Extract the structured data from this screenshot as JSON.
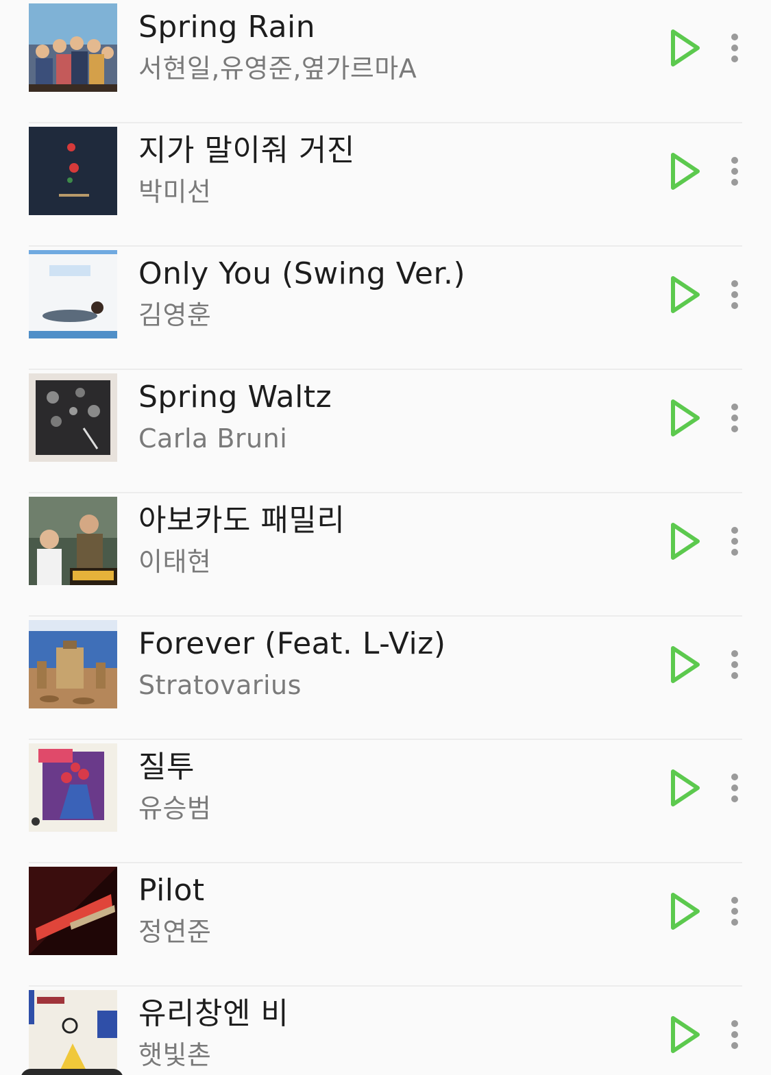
{
  "colors": {
    "accent": "#5cc94e",
    "title": "#1d1d1d",
    "artist": "#7a7a7a",
    "more": "#9a9a9a"
  },
  "songs": [
    {
      "title": "Spring Rain",
      "artist": "서현일,유영준,옆가르마A"
    },
    {
      "title": "지가 말이줘 거진",
      "artist": "박미선"
    },
    {
      "title": "Only You (Swing Ver.)",
      "artist": "김영훈"
    },
    {
      "title": "Spring Waltz",
      "artist": "Carla Bruni"
    },
    {
      "title": "아보카도 패밀리",
      "artist": "이태현"
    },
    {
      "title": "Forever (Feat. L-Viz)",
      "artist": "Stratovarius"
    },
    {
      "title": "질투",
      "artist": "유승범"
    },
    {
      "title": "Pilot",
      "artist": "정연준"
    },
    {
      "title": "유리창엔 비",
      "artist": "햇빛촌"
    }
  ],
  "icons": {
    "play": "play-icon",
    "more": "more-vert-icon"
  }
}
